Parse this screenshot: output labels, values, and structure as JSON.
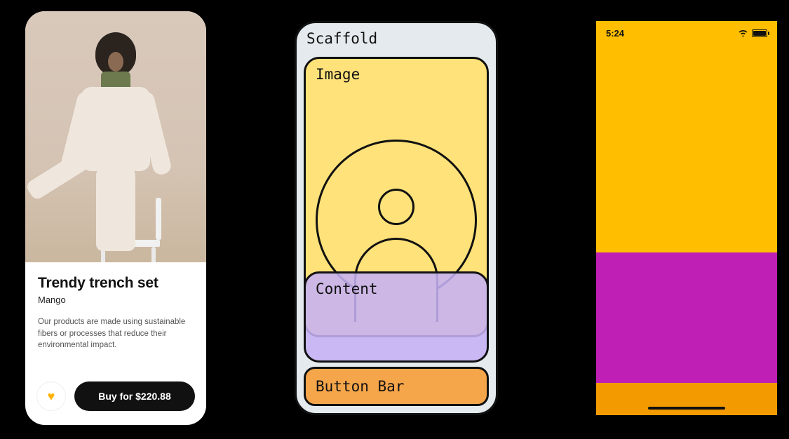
{
  "colors": {
    "accent_heart": "#ffb300",
    "diagram_scaffold_bg": "#e4eaee",
    "diagram_image_bg": "#ffe27a",
    "diagram_content_bg": "#c5b1f4",
    "diagram_buttonbar_bg": "#f5a54a",
    "phone3_top": "#ffbf00",
    "phone3_mid": "#bf1fb5",
    "phone3_bottom": "#f29a00"
  },
  "product": {
    "title": "Trendy trench set",
    "brand": "Mango",
    "description": "Our products are made using sustainable fibers or processes that reduce their environmental impact.",
    "buy_label": "Buy for $220.88",
    "price": "$220.88",
    "fav_icon_name": "heart-icon"
  },
  "diagram": {
    "scaffold_label": "Scaffold",
    "image_label": "Image",
    "content_label": "Content",
    "buttonbar_label": "Button Bar"
  },
  "status_bar": {
    "time": "5:24",
    "wifi_icon_name": "wifi-icon",
    "battery_icon_name": "battery-icon"
  }
}
